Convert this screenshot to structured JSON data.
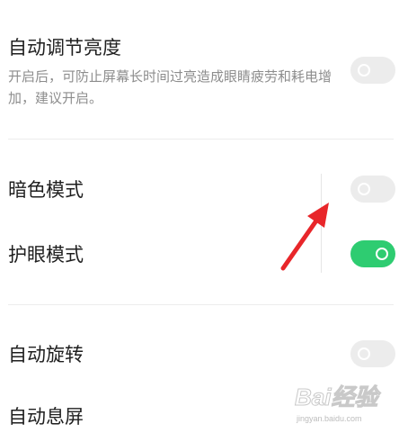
{
  "settings": {
    "auto_brightness": {
      "title": "自动调节亮度",
      "desc": "开启后，可防止屏幕长时间过亮造成眼睛疲劳和耗电增加，建议开启。",
      "enabled": false
    },
    "dark_mode": {
      "title": "暗色模式",
      "enabled": false
    },
    "eye_protection": {
      "title": "护眼模式",
      "enabled": true
    },
    "auto_rotate": {
      "title": "自动旋转",
      "enabled": false
    },
    "auto_screen_off": {
      "title": "自动息屏"
    }
  },
  "watermark": {
    "logo": "Bai经验",
    "url": "jingyan.baidu.com"
  },
  "colors": {
    "toggle_on": "#2ecc71",
    "toggle_off": "#ececec",
    "arrow": "#e8262a"
  }
}
